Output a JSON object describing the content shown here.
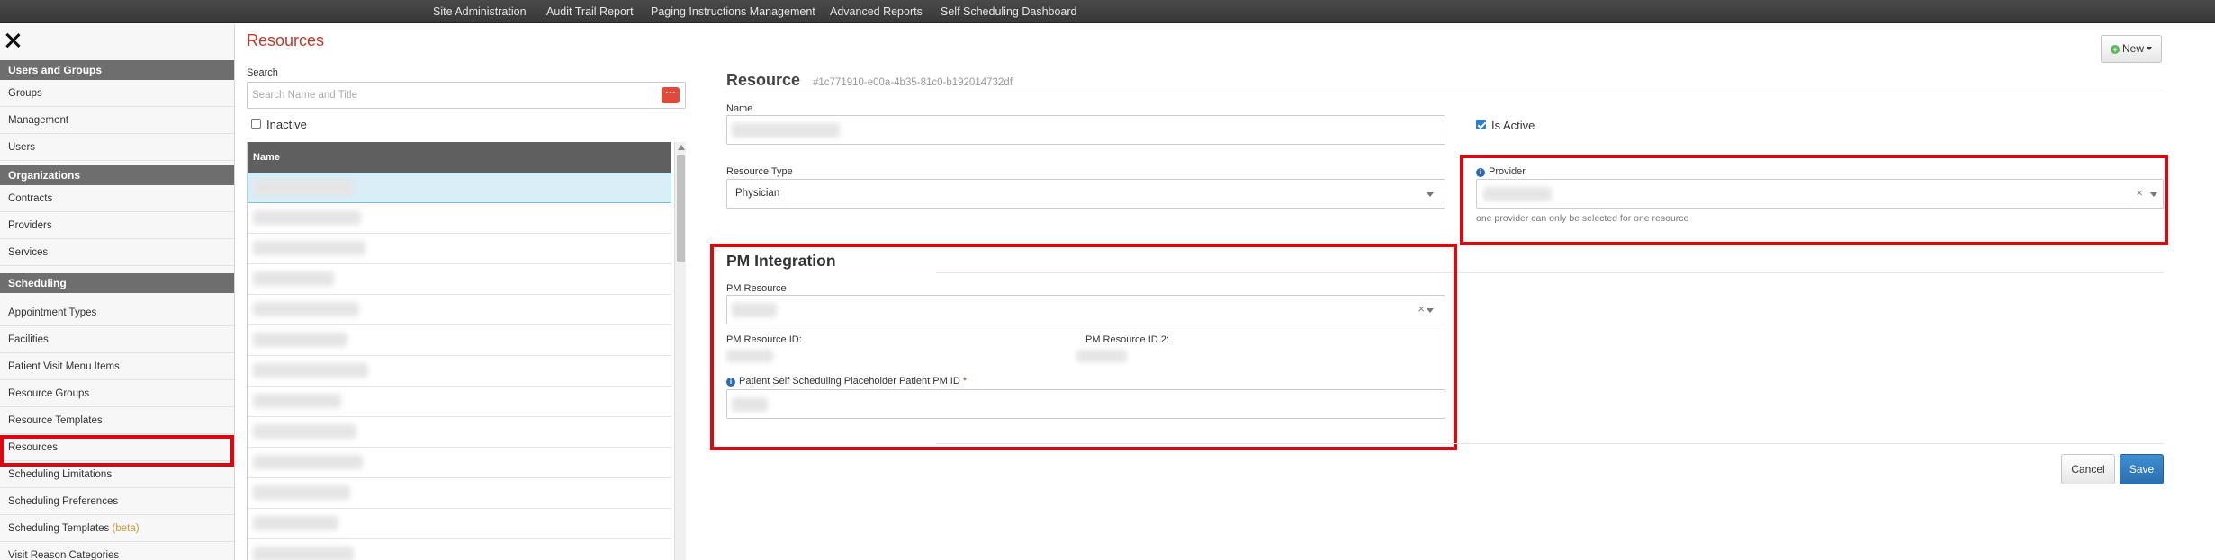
{
  "topnav": {
    "items": [
      "Site Administration",
      "Audit Trail Report",
      "Paging Instructions Management",
      "Advanced Reports",
      "Self Scheduling Dashboard"
    ]
  },
  "sidebar": {
    "sections": [
      {
        "title": "Users and Groups",
        "items": [
          "Groups",
          "Management",
          "Users"
        ]
      },
      {
        "title": "Organizations",
        "items": [
          "Contracts",
          "Providers",
          "Services"
        ]
      },
      {
        "title": "Scheduling",
        "items": [
          "Appointment Types",
          "Facilities",
          "Patient Visit Menu Items",
          "Resource Groups",
          "Resource Templates",
          "Resources",
          "Scheduling Limitations",
          "Scheduling Preferences",
          "Scheduling Templates",
          "Visit Reason Categories"
        ]
      }
    ],
    "beta_label": "(beta)",
    "active_item": "Resources"
  },
  "page": {
    "title": "Resources"
  },
  "search": {
    "label": "Search",
    "placeholder": "Search Name and Title",
    "inactive_label": "Inactive",
    "inactive_checked": false
  },
  "list": {
    "header": "Name"
  },
  "toolbar": {
    "new_label": "New"
  },
  "form": {
    "title": "Resource",
    "id": "#1c771910-e00a-4b35-81c0-b192014732df",
    "name_label": "Name",
    "is_active_label": "Is Active",
    "is_active_checked": true,
    "resource_type_label": "Resource Type",
    "resource_type_value": "Physician",
    "provider_label": "Provider",
    "provider_help": "one provider can only be selected for one resource",
    "pm_section_title": "PM Integration",
    "pm_resource_label": "PM Resource",
    "pm_resource_id_label": "PM Resource ID:",
    "pm_resource_id2_label": "PM Resource ID 2:",
    "placeholder_patient_label": "Patient Self Scheduling Placeholder Patient PM ID",
    "required_mark": "*",
    "cancel_label": "Cancel",
    "save_label": "Save"
  },
  "colors": {
    "accent_red": "#c0392b",
    "highlight_box": "#d9090f",
    "primary_blue": "#2a6fae"
  }
}
